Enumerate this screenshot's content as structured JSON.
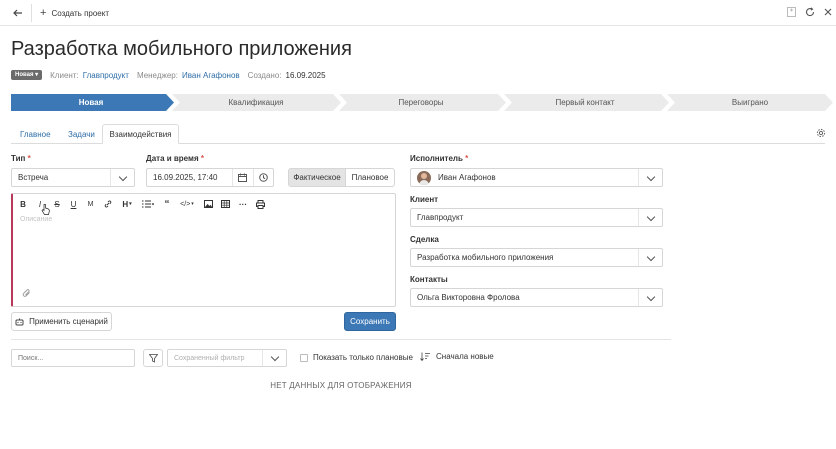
{
  "topbar": {
    "back_icon": "arrow-left-icon",
    "create_label": "Создать проект"
  },
  "page": {
    "title": "Разработка мобильного приложения",
    "status_badge": "Новая",
    "client_label": "Клиент:",
    "client_value": "Главпродукт",
    "manager_label": "Менеджер:",
    "manager_value": "Иван Агафонов",
    "created_label": "Создано:",
    "created_value": "16.09.2025"
  },
  "pipeline": {
    "stages": [
      "Новая",
      "Квалификация",
      "Переговоры",
      "Первый контакт",
      "Выиграно"
    ],
    "active_color": "#3b78b5"
  },
  "tabs": [
    "Главное",
    "Задачи",
    "Взаимодействия"
  ],
  "form": {
    "type_label": "Тип",
    "type_value": "Встреча",
    "datetime_label": "Дата и время",
    "datetime_value": "16.09.2025, 17:40",
    "toggle_actual": "Фактическое",
    "toggle_planned": "Плановое",
    "toolbar": [
      "B",
      "I",
      "S",
      "U",
      "M",
      "link",
      "H",
      "list",
      "quote",
      "code",
      "image",
      "table",
      "more",
      "print"
    ],
    "description_placeholder": "Описание",
    "apply_scenario": "Применить сценарий",
    "save": "Сохранить"
  },
  "right": {
    "executor_label": "Исполнитель",
    "executor_value": "Иван Агафонов",
    "client_label": "Клиент",
    "client_value": "Главпродукт",
    "deal_label": "Сделка",
    "deal_value": "Разработка мобильного приложения",
    "contacts_label": "Контакты",
    "contacts_value": "Ольга Викторовна Фролова"
  },
  "filters": {
    "search_placeholder": "Поиск...",
    "saved_filter_placeholder": "Сохраненный фильтр",
    "only_planned": "Показать только плановые",
    "sort": "Сначала новые"
  },
  "empty": "НЕТ ДАННЫХ ДЛЯ ОТОБРАЖЕНИЯ"
}
